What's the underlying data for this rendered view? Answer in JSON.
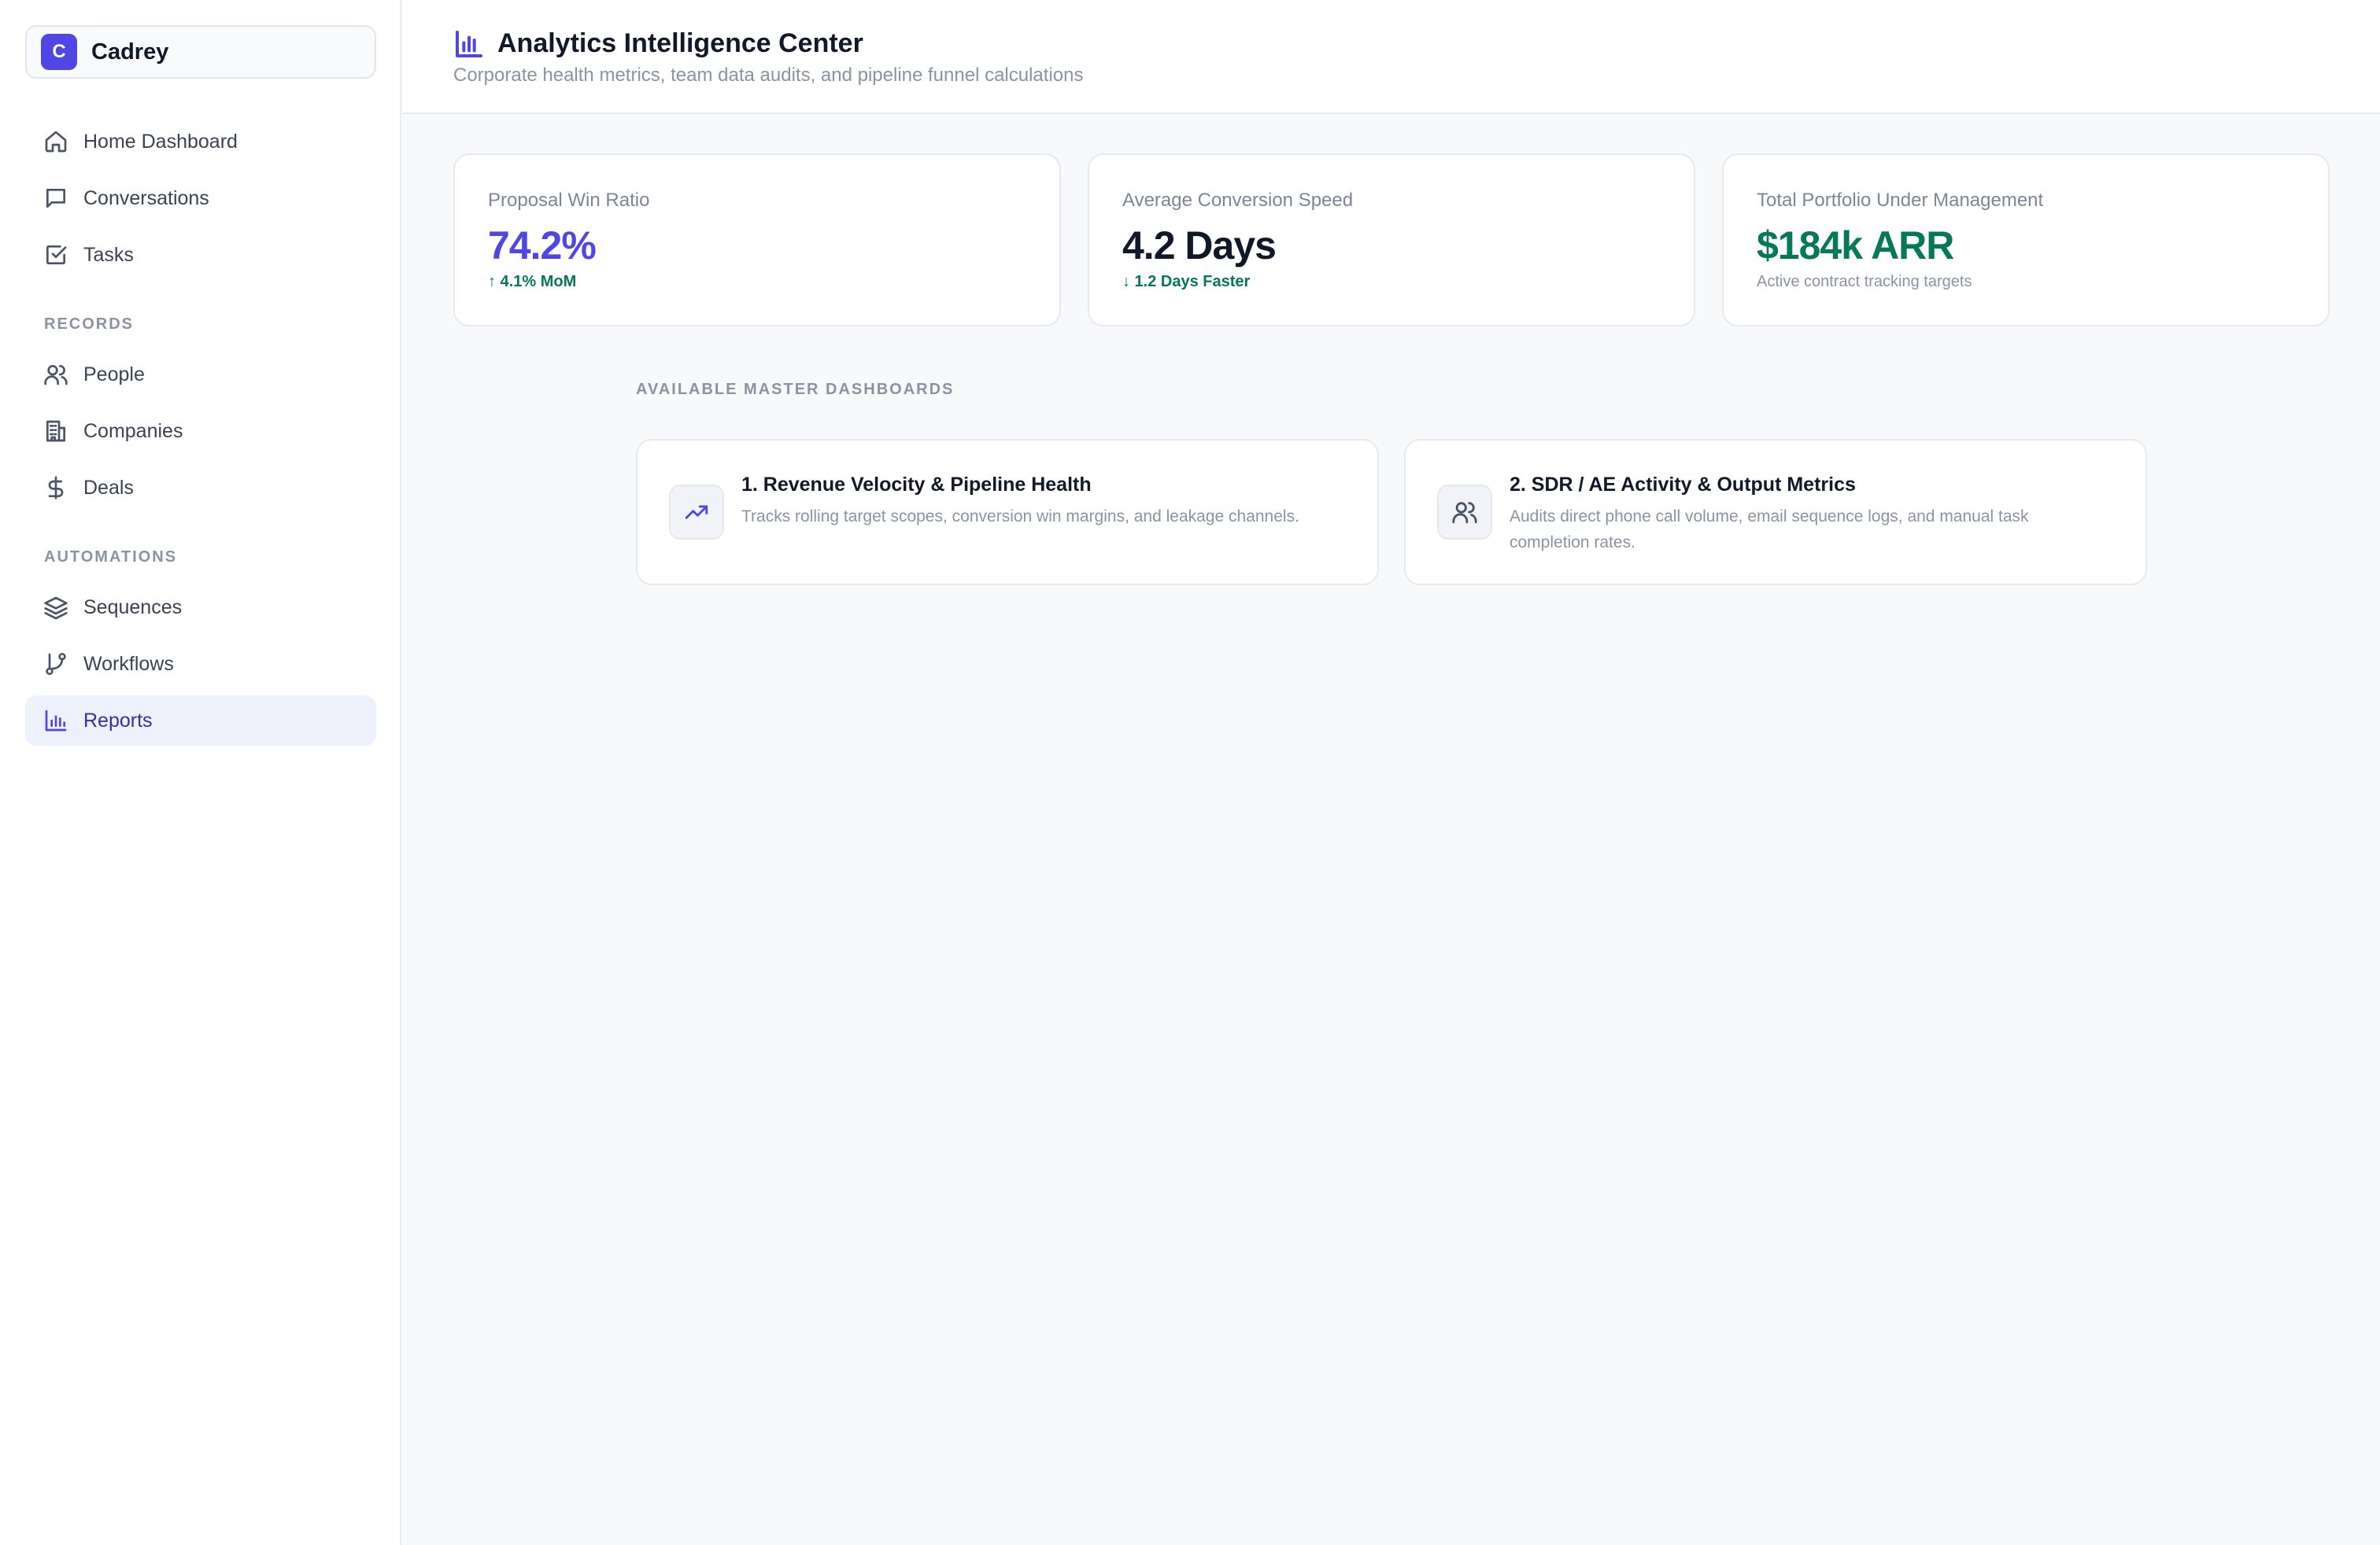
{
  "brand": {
    "logo_letter": "C",
    "name": "Cadrey"
  },
  "sidebar": {
    "main_items": [
      {
        "label": "Home Dashboard",
        "icon": "home-icon"
      },
      {
        "label": "Conversations",
        "icon": "message-icon"
      },
      {
        "label": "Tasks",
        "icon": "task-check-icon"
      }
    ],
    "records_label": "RECORDS",
    "records_items": [
      {
        "label": "People",
        "icon": "people-icon"
      },
      {
        "label": "Companies",
        "icon": "building-icon"
      },
      {
        "label": "Deals",
        "icon": "dollar-icon"
      }
    ],
    "automations_label": "AUTOMATIONS",
    "automations_items": [
      {
        "label": "Sequences",
        "icon": "layers-icon"
      },
      {
        "label": "Workflows",
        "icon": "git-branch-icon"
      },
      {
        "label": "Reports",
        "icon": "bar-chart-icon",
        "active": true
      }
    ]
  },
  "header": {
    "title": "Analytics Intelligence Center",
    "subtitle": "Corporate health metrics, team data audits, and pipeline funnel calculations",
    "icon": "bar-chart-icon"
  },
  "kpis": [
    {
      "label": "Proposal Win Ratio",
      "value": "74.2%",
      "sub": "↑ 4.1% MoM",
      "value_color": "#4f46e5"
    },
    {
      "label": "Average Conversion Speed",
      "value": "4.2 Days",
      "sub": "↓ 1.2 Days Faster",
      "value_color": "#111827"
    },
    {
      "label": "Total Portfolio Under Management",
      "value": "$184k ARR",
      "sub": "Active contract tracking targets",
      "value_color": "#047857"
    }
  ],
  "dashboards": {
    "section_label": "AVAILABLE MASTER DASHBOARDS",
    "items": [
      {
        "title": "1. Revenue Velocity & Pipeline Health",
        "description": "Tracks rolling target scopes, conversion win margins, and leakage channels.",
        "icon": "trending-up-icon"
      },
      {
        "title": "2. SDR / AE Activity & Output Metrics",
        "description": "Audits direct phone call volume, email sequence logs, and manual task completion rates.",
        "icon": "people-icon"
      }
    ]
  },
  "colors": {
    "accent": "#4f46e5",
    "success": "#047857",
    "active_bg": "#eef0fc"
  }
}
